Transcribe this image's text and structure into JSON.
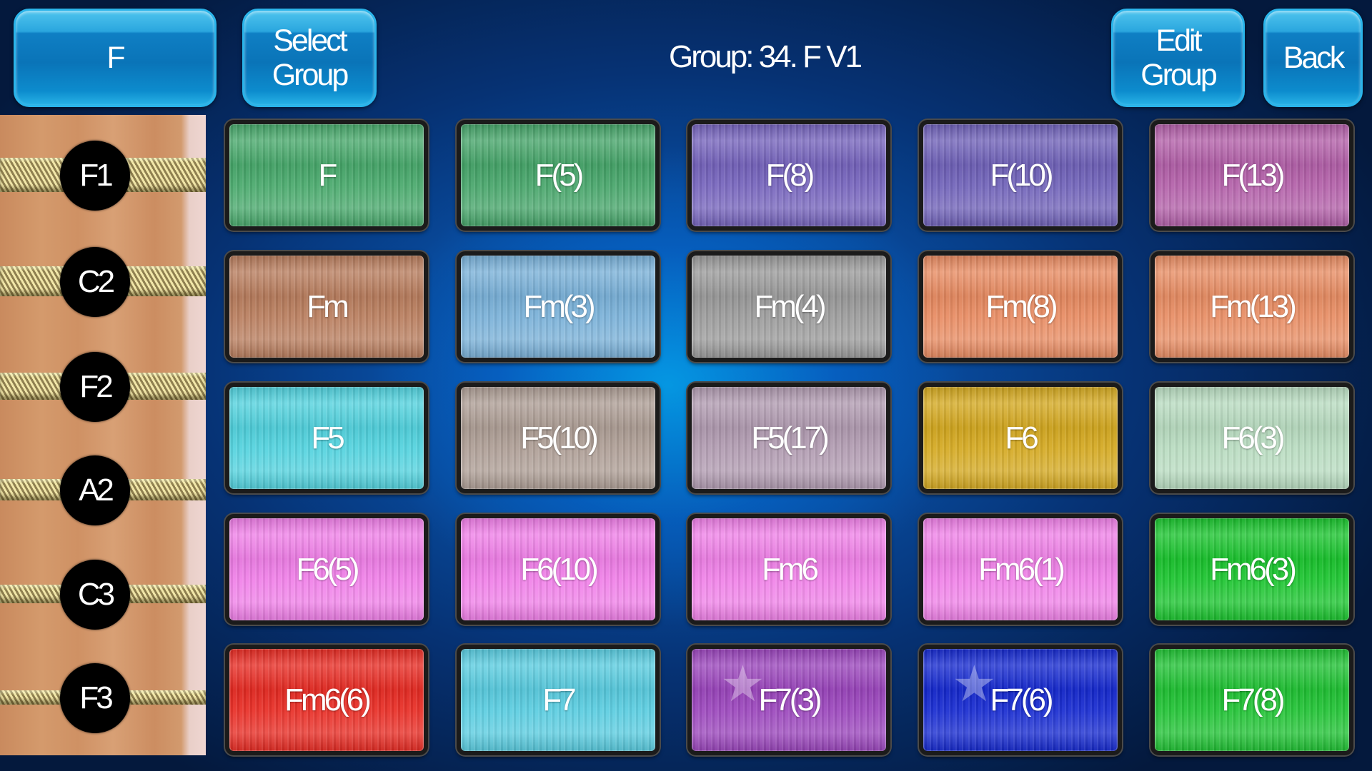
{
  "header": {
    "key_button": "F",
    "select_group_button": [
      "Select",
      "Group"
    ],
    "group_title": "Group: 34. F V1",
    "edit_group_button": [
      "Edit",
      "Group"
    ],
    "back_button": "Back"
  },
  "fretboard": {
    "notes": [
      "F1",
      "C2",
      "F2",
      "A2",
      "C3",
      "F3"
    ]
  },
  "pads": {
    "rows": [
      [
        {
          "label": "F",
          "color": "#46a86a"
        },
        {
          "label": "F(5)",
          "color": "#44a468"
        },
        {
          "label": "F(8)",
          "color": "#7462bc"
        },
        {
          "label": "F(10)",
          "color": "#6e60b8"
        },
        {
          "label": "F(13)",
          "color": "#b25ea8"
        }
      ],
      [
        {
          "label": "Fm",
          "color": "#b87c5c"
        },
        {
          "label": "Fm(3)",
          "color": "#78b0d8"
        },
        {
          "label": "Fm(4)",
          "color": "#9a9a9a"
        },
        {
          "label": "Fm(8)",
          "color": "#e88a60"
        },
        {
          "label": "Fm(13)",
          "color": "#e88c62"
        }
      ],
      [
        {
          "label": "F5",
          "color": "#50d2de"
        },
        {
          "label": "F5(10)",
          "color": "#ad9d94"
        },
        {
          "label": "F5(17)",
          "color": "#b09ab0"
        },
        {
          "label": "F6",
          "color": "#d4a81e"
        },
        {
          "label": "F6(3)",
          "color": "#b8dcc0"
        }
      ],
      [
        {
          "label": "F6(5)",
          "color": "#f07ee8"
        },
        {
          "label": "F6(10)",
          "color": "#f07ee8"
        },
        {
          "label": "Fm6",
          "color": "#f080e8"
        },
        {
          "label": "Fm6(1)",
          "color": "#f080e8"
        },
        {
          "label": "Fm6(3)",
          "color": "#18c42c"
        }
      ],
      [
        {
          "label": "Fm6(6)",
          "color": "#e82a22"
        },
        {
          "label": "F7",
          "color": "#58cce0"
        },
        {
          "label": "F7(3)",
          "color": "#9a44bc"
        },
        {
          "label": "F7(6)",
          "color": "#1428d0"
        },
        {
          "label": "F7(8)",
          "color": "#1ec232"
        }
      ]
    ]
  }
}
